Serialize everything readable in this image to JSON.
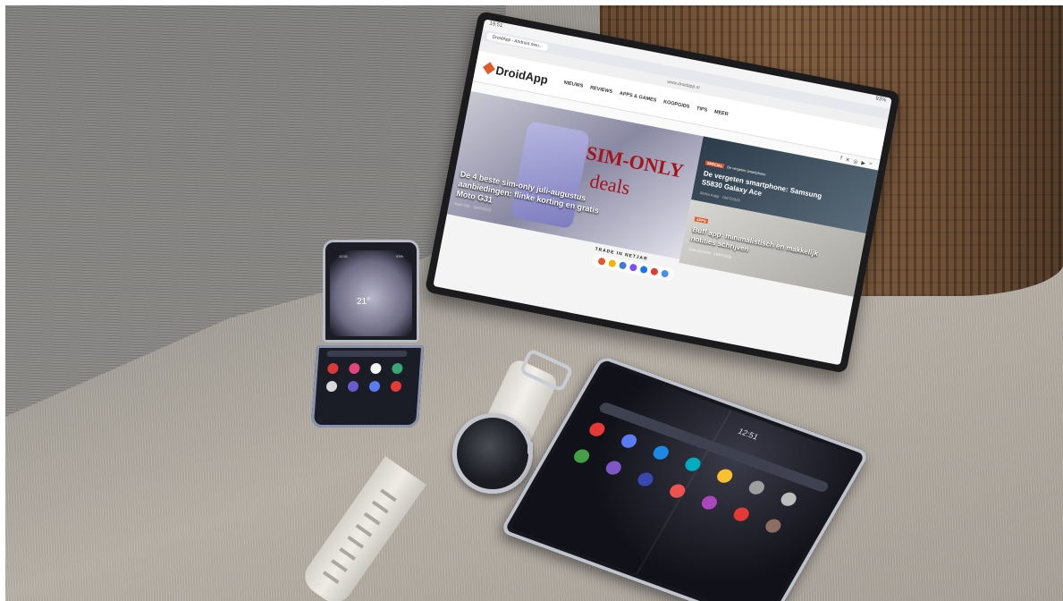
{
  "tablet": {
    "status_time": "19:51",
    "status_right": "93%",
    "browser_tab": "DroidApp - Android nieu...",
    "url": "www.droidapp.nl",
    "site_logo": "DroidApp",
    "nav": [
      "NIEUWS",
      "REVIEWS",
      "APPS & GAMES",
      "KOOPGIDS",
      "TIPS",
      "MEER"
    ],
    "hero": {
      "overlay_line1": "SIM-ONLY",
      "overlay_line2": "deals",
      "title": "De 4 beste sim-only juli-augustus aanbiedingen: flinke korting en gratis Moto G31",
      "meta": "Daan Gijs · 19/07/2023"
    },
    "side_story_1": {
      "badge_tag": "SPECIAL",
      "badge_text": "De vergeten smartphone",
      "title": "De vergeten smartphone: Samsung S5830 Galaxy Ace",
      "meta": "Stefan Kapp · 19/07/2023"
    },
    "side_story_2": {
      "badge_tag": "APPS",
      "title": "Buff app: minimalistisch en makkelijk notities schrijven",
      "meta": "Loris Gummel · 19/07/2023"
    },
    "banner_text": "TRADE IN NETJAR",
    "dock_colors": [
      "#e05a2b",
      "#f2b400",
      "#3a7bd5",
      "#7c4dff",
      "#1a73e8",
      "#e53935",
      "#4a90e2"
    ]
  },
  "flip_phone": {
    "status_left": "12:51",
    "status_right": "93%",
    "temperature": "21°",
    "app_colors": [
      "#d83a3a",
      "#e0467a",
      "#f5f5f5",
      "#3aa675",
      "#d8d8d8",
      "#6a5acd",
      "#5b7cf0",
      "#e53935"
    ]
  },
  "fold_phone": {
    "clock": "12:51",
    "app_colors": [
      "#e53935",
      "#5b7cf0",
      "#1e88e5",
      "#00acc1",
      "#fbc02d",
      "#9e9e9e",
      "#bdbdbd",
      "#43a047",
      "#7e57c2",
      "#3949ab",
      "#ef5350",
      "#ab47bc",
      "#e53935",
      "#8d6e63"
    ]
  }
}
